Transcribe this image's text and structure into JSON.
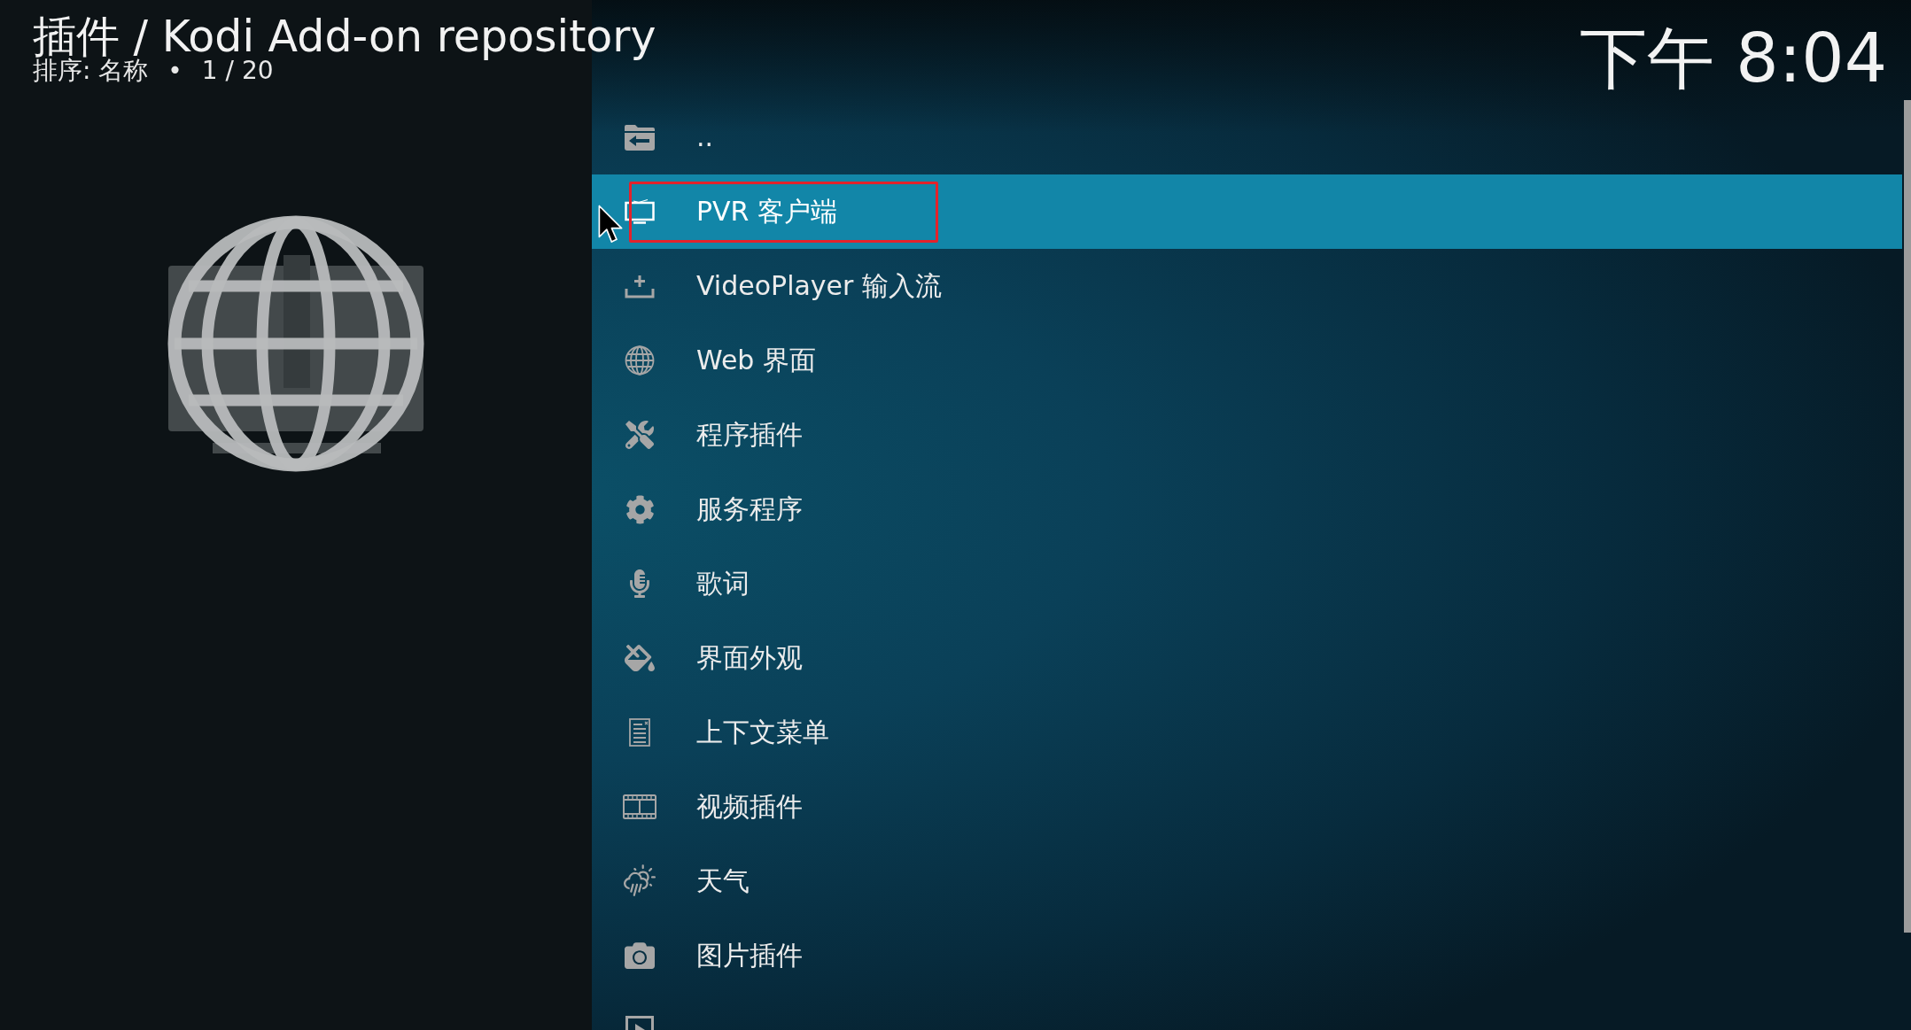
{
  "header": {
    "title": "插件 / Kodi Add-on repository",
    "sort": "排序: 名称",
    "separator": "•",
    "position": "1 / 20"
  },
  "clock": "下午 8:04",
  "list": {
    "items": [
      {
        "label": "..",
        "selected": false,
        "marked": false
      },
      {
        "label": "PVR 客户端",
        "selected": true,
        "marked": true
      },
      {
        "label": "VideoPlayer 输入流",
        "selected": false,
        "marked": false
      },
      {
        "label": "Web 界面",
        "selected": false,
        "marked": false
      },
      {
        "label": "程序插件",
        "selected": false,
        "marked": false
      },
      {
        "label": "服务程序",
        "selected": false,
        "marked": false
      },
      {
        "label": "歌词",
        "selected": false,
        "marked": false
      },
      {
        "label": "界面外观",
        "selected": false,
        "marked": false
      },
      {
        "label": "上下文菜单",
        "selected": false,
        "marked": false
      },
      {
        "label": "视频插件",
        "selected": false,
        "marked": false
      },
      {
        "label": "天气",
        "selected": false,
        "marked": false
      },
      {
        "label": "图片插件",
        "selected": false,
        "marked": false
      },
      {
        "selected": false,
        "marked": false
      }
    ]
  }
}
